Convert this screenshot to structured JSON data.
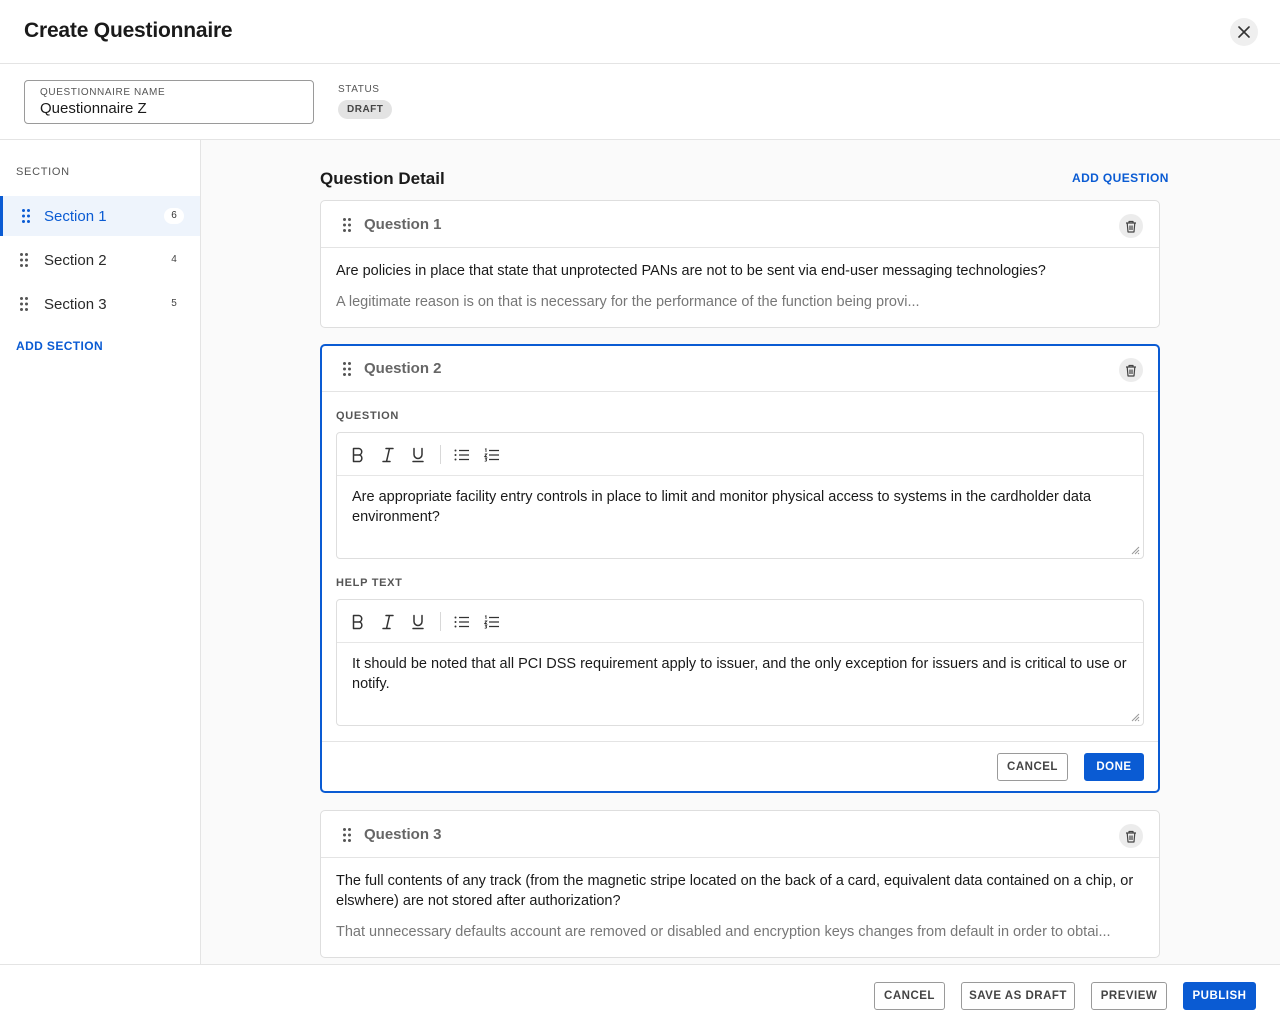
{
  "header": {
    "title": "Create Questionnaire",
    "close_icon": "close-icon"
  },
  "meta": {
    "name_label": "QUESTIONNAIRE NAME",
    "name_value": "Questionnaire Z",
    "status_label": "STATUS",
    "status_value": "DRAFT"
  },
  "sidebar": {
    "title": "SECTION",
    "items": [
      {
        "label": "Section 1",
        "count": "6",
        "active": true
      },
      {
        "label": "Section 2",
        "count": "4",
        "active": false
      },
      {
        "label": "Section 3",
        "count": "5",
        "active": false
      }
    ],
    "add_label": "ADD SECTION"
  },
  "main": {
    "title": "Question Detail",
    "add_label": "ADD QUESTION",
    "questions": [
      {
        "title": "Question 1",
        "text": "Are policies in place that state that unprotected PANs are not to be sent via end-user messaging technologies?",
        "help": "A legitimate reason is on that is necessary for the performance of the function being provi..."
      },
      {
        "title": "Question 2",
        "question_label": "QUESTION",
        "help_label": "HELP TEXT",
        "text": "Are appropriate facility entry controls in place to limit and monitor physical access to systems in the cardholder data environment?",
        "help": "It should be noted that all PCI DSS requirement apply to issuer, and the only exception for issuers and is critical to use or notify.",
        "cancel_label": "CANCEL",
        "done_label": "DONE"
      },
      {
        "title": "Question 3",
        "text": "The full contents of any track (from the magnetic stripe located on the back of a card, equivalent data contained on a chip, or elswhere) are not stored after authorization?",
        "help": "That unnecessary defaults account are removed or disabled and encryption keys changes from default in order to obtai..."
      }
    ]
  },
  "footer": {
    "cancel_label": "CANCEL",
    "draft_label": "SAVE AS DRAFT",
    "preview_label": "PREVIEW",
    "publish_label": "PUBLISH"
  },
  "colors": {
    "accent": "#0a5bd3",
    "border": "#dedede"
  }
}
